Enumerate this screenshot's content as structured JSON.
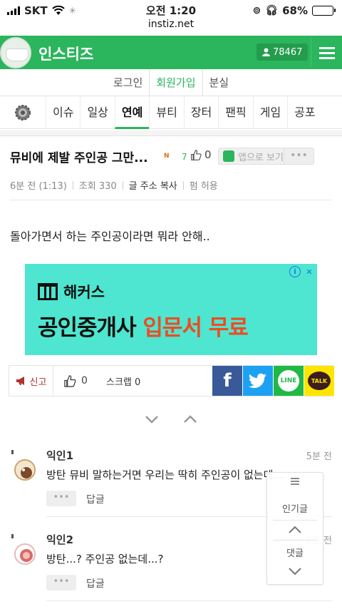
{
  "status_bar": {
    "carrier": "SKT",
    "time": "오전 1:20",
    "url": "instiz.net",
    "battery": "68%",
    "battery_level": 0.68
  },
  "header": {
    "brand": "인스티즈",
    "points": "78467",
    "accent_color": "#2bb55c"
  },
  "auth": {
    "login": "로그인",
    "signup": "회원가입",
    "tab3": "분실"
  },
  "categories": [
    "이슈",
    "일상",
    "연예",
    "뷰티",
    "장터",
    "팬픽",
    "게임",
    "공포"
  ],
  "active_category": "연예",
  "post": {
    "title": "뮤비에 제발 주인공 그만...",
    "new_badge": "N",
    "comment_count": "7",
    "likes": "0",
    "app_button": "앱으로 보기",
    "more": "•••",
    "posted": "6분 전 (1:13)",
    "views": "조회 330",
    "copy_url": "글 주소 복사",
    "permission": "펌 허용",
    "body": "돌아가면서 하는 주인공이라면 뭐라 안해.."
  },
  "ad": {
    "brand": "해커스",
    "headline_prefix": "공인중개사 ",
    "headline_highlight": "입문서 무료",
    "info_icon": "i",
    "close_icon": "✕"
  },
  "actions": {
    "report": "신고",
    "likes": "0",
    "scrap": "스크랩 0"
  },
  "share": {
    "facebook": "f",
    "line": "LINE",
    "kakao": "TALK"
  },
  "comments": [
    {
      "name": "익인1",
      "time": "5분 전",
      "text": "방탄 뮤비 말하는거면 우리는 딱히 주인공이 없는데...",
      "more": "•••",
      "reply": "답글"
    },
    {
      "name": "익인2",
      "time": "5분 전",
      "text": "방탄...? 주인공 없는데...?",
      "more": "•••",
      "reply": "답글"
    }
  ],
  "float_panel": {
    "popular": "인기글",
    "comments": "댓글"
  }
}
